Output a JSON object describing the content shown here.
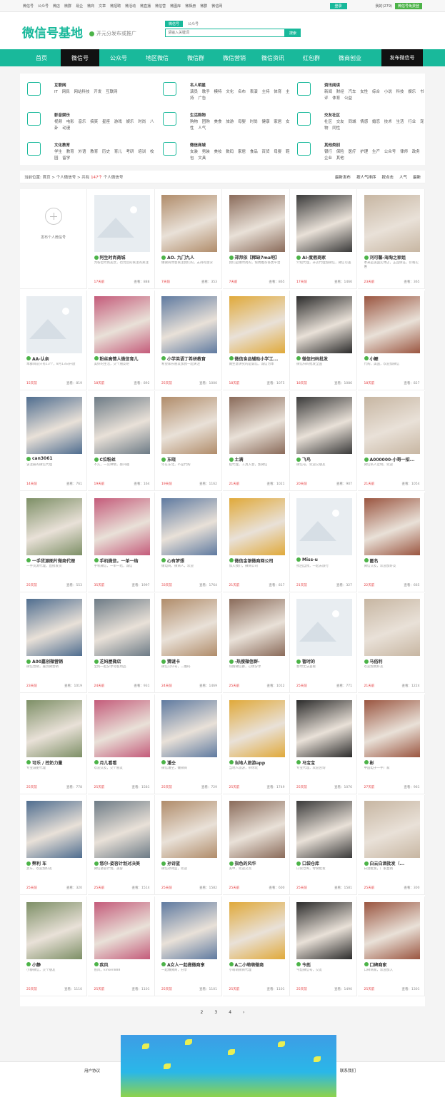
{
  "topbar": {
    "links": [
      "微信号",
      "公众号",
      "微店",
      "微群",
      "易企",
      "微商",
      "文章",
      "微招聘",
      "微活动",
      "微直播",
      "微信营",
      "微图库",
      "微相册",
      "微群",
      "微信网"
    ],
    "login": "登录",
    "balance": "我的(279)",
    "publish": "微信号免费登"
  },
  "header": {
    "logo": "微信号基地",
    "slogan": "开元分发布或推广",
    "tab_active": "微信号",
    "tab_other": "公众号",
    "search_placeholder": "请输入关键词",
    "search_button": "搜索"
  },
  "nav": {
    "items": [
      "首页",
      "微信号",
      "公众号",
      "地区微信",
      "微信群",
      "微信营销",
      "微信资讯",
      "红包群",
      "微商创业"
    ],
    "publish": "发布微信号"
  },
  "categories": [
    {
      "title": "互联网",
      "links": "IT 网民 网站科技 开发 互联网"
    },
    {
      "title": "名人明星",
      "links": "演员 歌手 模特 文化 名布 表演 主持 体育 主持 广告"
    },
    {
      "title": "资讯阅读",
      "links": "新闻 财经 汽车 女性 综合 小说 科技 娱乐 书评 体育 公益"
    },
    {
      "title": "影音娱乐",
      "links": "视频 电影 音乐 搞笑 星座 游戏 娱乐 时尚 八卦 动漫"
    },
    {
      "title": "生活购物",
      "links": "购物 团购 美食 旅游 母婴 时尚 健康 家居 女性 人气"
    },
    {
      "title": "交友社区",
      "links": "社区 交友 同城 情感 婚恋 技术 生活 行业 宠物 同性"
    },
    {
      "title": "文化教育",
      "links": "学生 教育 外语 教育 历史 育儿 考研 培训 校园 留学"
    },
    {
      "title": "微信商城",
      "links": "女装 男装 美妆 数码 家居 食品 百货 母婴 鞋包 文具"
    },
    {
      "title": "其他类别",
      "links": "银行 保险 医疗 护理 生产 公众号 律师 政务 企业 其他"
    }
  ],
  "list": {
    "crumb_prefix": "当前位置: 首页 > 个人微信号 > 共有",
    "count": "147个",
    "crumb_suffix": "个人微信号",
    "sort": [
      "最新发布",
      "按人气排序",
      "按点击",
      "人气",
      "最新"
    ]
  },
  "add_card": {
    "text": "发布个人微信号"
  },
  "cards": [
    {
      "name": "阿生时尚商城",
      "desc": "为各位时尚美女，也为您的关注的关注",
      "days": "17天前",
      "views": "查看：888"
    },
    {
      "name": "AO. 九门九人",
      "desc": "做微商你会关注我们的，支持有需求",
      "days": "7天前",
      "views": "查看：353"
    },
    {
      "name": "郑邦依【稀缺7ma吧】",
      "desc": "我们是做时尚的，免费推荐各类平台",
      "days": "7天前",
      "views": "查看：865"
    },
    {
      "name": "AI·度假商家",
      "desc": "介绍代理，开店代理加微信，微信可查",
      "days": "17天前",
      "views": "查看：1466"
    },
    {
      "name": "刘可馨-海淘之家姐",
      "desc": "本来是美国实体店，正品保证，价格实惠",
      "days": "23天前",
      "views": "查看：365"
    },
    {
      "name": "AA-认亲",
      "desc": "本群目前只有13个，8月13日开放",
      "days": "15天前",
      "views": "查看：819"
    },
    {
      "name": "粉丝高情人微信育儿",
      "desc": "美好的生活，交个朋友吧",
      "days": "18天前",
      "views": "查看：892"
    },
    {
      "name": "小学英语丁希研教育",
      "desc": "希望家长朋友加我一起关注",
      "days": "25天前",
      "views": "查看：1000"
    },
    {
      "name": "微信食品辅助小学工...",
      "desc": "做生意讲究的是诚信，诚信为本",
      "days": "18天前",
      "views": "查看：1075"
    },
    {
      "name": "微信扫码批发",
      "desc": "微信扫码批发全国",
      "days": "18天前",
      "views": "查看：1086"
    },
    {
      "name": "小鲤",
      "desc": "代购，美国，欢迎加微信",
      "days": "18天前",
      "views": "查看：827"
    },
    {
      "name": "can3061",
      "desc": "该注册的微信代理",
      "days": "14天前",
      "views": "查看：761"
    },
    {
      "name": "C位粉丝",
      "desc": "不久，一见钟情，感兴趣",
      "days": "19天前",
      "views": "查看：164"
    },
    {
      "name": "东晓",
      "desc": "年在东北，不是代购",
      "days": "19天前",
      "views": "查看：1162"
    },
    {
      "name": "土满",
      "desc": "招代理，工具入会，加微信",
      "days": "21天前",
      "views": "查看：1021"
    },
    {
      "name": "飞鸟",
      "desc": "微信号，欢迎交朋友",
      "days": "20天前",
      "views": "查看：907"
    },
    {
      "name": "A000000-小哥一招...",
      "desc": "微信私人定制，欢迎",
      "days": "21天前",
      "views": "查看：1054"
    },
    {
      "name": "一手货源图片微商代理",
      "desc": "一手货源代理，直接发货",
      "days": "25天前",
      "views": "查看：553"
    },
    {
      "name": "手机微信，一单一结",
      "desc": "手机微信，一单一结，诚信",
      "days": "35天前",
      "views": "查看：1997"
    },
    {
      "name": "心有梦想",
      "desc": "做电商，微商人，欢迎",
      "days": "33天前",
      "views": "查看：1764"
    },
    {
      "name": "微信金银微商网公司",
      "desc": "加入我们，微商公司",
      "days": "21天前",
      "views": "查看：817"
    },
    {
      "name": "Miss-u",
      "desc": "找回自我，一起去旅行",
      "days": "21天前",
      "views": "查看：327"
    },
    {
      "name": "匿名",
      "desc": "微信交友，欢迎加好友",
      "days": "22天前",
      "views": "查看：665"
    },
    {
      "name": "A00嘉创微营销",
      "desc": "微信营销，嘉创微营销",
      "days": "23天前",
      "views": "查看：1019"
    },
    {
      "name": "芝妈屋微店",
      "desc": "宝妈一起分享母婴用品",
      "days": "24天前",
      "views": "查看：931"
    },
    {
      "name": "猜谜卡",
      "desc": "微信公众号，二维码",
      "days": "24天前",
      "views": "查看：1469"
    },
    {
      "name": "-热搜微信群-",
      "desc": "热搜微信群，心情分享",
      "days": "25天前",
      "views": "查看：1012"
    },
    {
      "name": "暂时的",
      "desc": "暂时无法查看",
      "days": "25天前",
      "views": "查看：771"
    },
    {
      "name": "马俗利",
      "desc": "欢迎加我好友",
      "days": "21天前",
      "views": "查看：1224"
    },
    {
      "name": "可乐 / 控奶力量",
      "desc": "专业减肥代理",
      "days": "25天前",
      "views": "查看：778"
    },
    {
      "name": "月儿看看",
      "desc": "欢迎交友，交个朋友",
      "days": "25天前",
      "views": "查看：1581"
    },
    {
      "name": "潘仝",
      "desc": "微信潘仝，做微商",
      "days": "25天前",
      "views": "查看：729"
    },
    {
      "name": "当地人旅游app",
      "desc": "当地人旅游，带你玩",
      "days": "25天前",
      "views": "查看：1749"
    },
    {
      "name": "马宝宝",
      "desc": "专业代理，欢迎咨询",
      "days": "25天前",
      "views": "查看：1076"
    },
    {
      "name": "彬",
      "desc": "中国电子一手厂家",
      "days": "27天前",
      "views": "查看：961"
    },
    {
      "name": "弊利  车",
      "desc": "卖车，欢迎加好友",
      "days": "25天前",
      "views": "查看：320"
    },
    {
      "name": "悠尔-姿容计划对决美",
      "desc": "微信姿容计划，美容",
      "days": "25天前",
      "views": "查看：1514"
    },
    {
      "name": "孙诗蓝",
      "desc": "微信孙诗蓝，欢迎",
      "days": "25天前",
      "views": "查看：1582"
    },
    {
      "name": "指色的风华",
      "desc": "美甲，欢迎交流",
      "days": "25天前",
      "views": "查看：600"
    },
    {
      "name": "口袋仓库",
      "desc": "口袋仓库，零食批发",
      "days": "25天前",
      "views": "查看：1581"
    },
    {
      "name": "白云白酒批发（...",
      "desc": "白酒批发，厂家直销",
      "days": "25天前",
      "views": "查看：300"
    },
    {
      "name": "小静",
      "desc": "小静微信，交个朋友",
      "days": "25天前",
      "views": "查看：1110"
    },
    {
      "name": "疾风",
      "desc": "疾风，kinken888",
      "days": "25天前",
      "views": "查看：1101"
    },
    {
      "name": "A女人一起做微商享",
      "desc": "一起做微商，分享",
      "days": "25天前",
      "views": "查看：1101"
    },
    {
      "name": "A二小萌萌微商",
      "desc": "小萌萌微商代理",
      "days": "25天前",
      "views": "查看：1101"
    },
    {
      "name": "今彪",
      "desc": "今彪微信号，交友",
      "days": "25天前",
      "views": "查看：1490"
    },
    {
      "name": "口碑商家",
      "desc": "口碑商家，欢迎加入",
      "days": "25天前",
      "views": "查看：1301"
    }
  ],
  "pager": [
    "2",
    "3",
    "4",
    "›"
  ],
  "footer": {
    "links": [
      "用户协议",
      "联系我们"
    ]
  }
}
